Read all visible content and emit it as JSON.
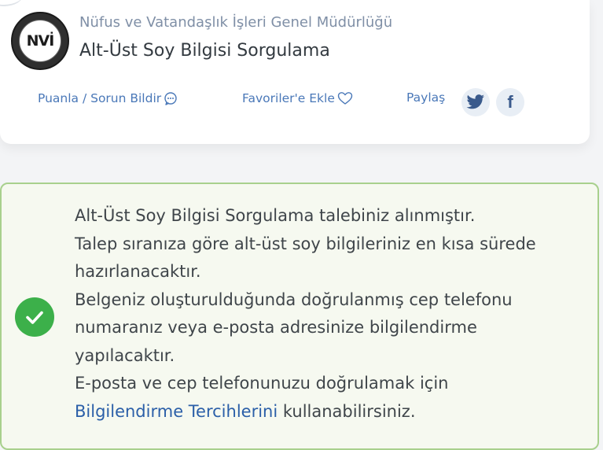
{
  "header": {
    "org_name": "Nüfus ve Vatandaşlık İşleri Genel Müdürlüğü",
    "page_title": "Alt-Üst Soy Bilgisi Sorgulama",
    "logo_text": "NVİ"
  },
  "actions": {
    "rate_label": "Puanla / Sorun Bildir",
    "favorite_label": "Favoriler'e Ekle",
    "share_label": "Paylaş"
  },
  "colors": {
    "accent_blue": "#4a78b8",
    "success_green": "#3cb04a",
    "alert_border": "#a8d08d",
    "alert_background": "#f6f9f0"
  },
  "icons": {
    "rate": "comment-icon",
    "favorite": "heart-icon",
    "twitter": "twitter-icon",
    "facebook": "facebook-icon",
    "status": "check-circle-icon"
  },
  "message": {
    "line1": "Alt-Üst Soy Bilgisi Sorgulama talebiniz alınmıştır.",
    "line2": "Talep sıranıza göre alt-üst soy bilgileriniz en kısa sürede",
    "line3": "hazırlanacaktır.",
    "line4": "Belgeniz oluşturulduğunda doğrulanmış cep telefonu",
    "line5": "numaranız veya e-posta adresinize bilgilendirme",
    "line6": "yapılacaktır.",
    "line7": "E-posta ve cep telefonunuzu doğrulamak için",
    "link_text": "Bilgilendirme Tercihlerini",
    "line8_suffix": " kullanabilirsiniz."
  }
}
